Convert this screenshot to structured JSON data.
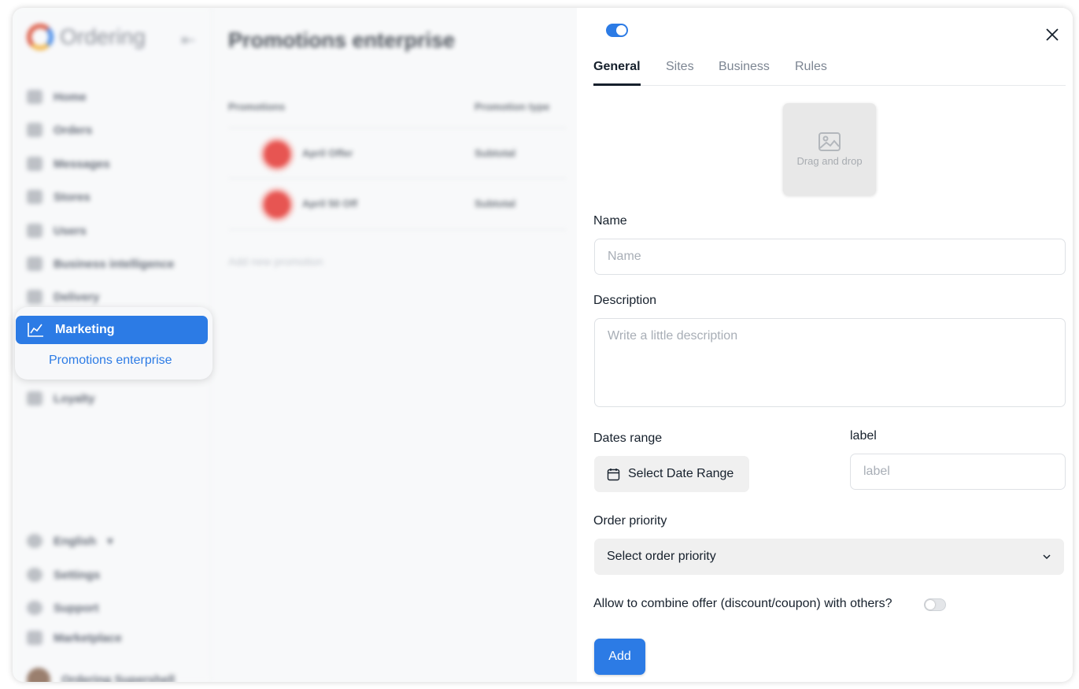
{
  "app": {
    "logo_text": "Ordering",
    "page_title": "Promotions enterprise"
  },
  "sidebar": {
    "items": [
      {
        "label": "Home"
      },
      {
        "label": "Orders"
      },
      {
        "label": "Messages"
      },
      {
        "label": "Stores"
      },
      {
        "label": "Users"
      },
      {
        "label": "Business intelligence"
      },
      {
        "label": "Delivery"
      },
      {
        "label": "Marketing",
        "active": true
      },
      {
        "label": "Loyalty"
      }
    ],
    "submenu": {
      "label": "Promotions enterprise"
    },
    "footer": [
      {
        "label": "English"
      },
      {
        "label": "Settings"
      },
      {
        "label": "Support"
      },
      {
        "label": "Marketplace"
      },
      {
        "label": "Ordering Supershell"
      }
    ]
  },
  "table": {
    "columns": [
      "Promotions",
      "Promotion type"
    ],
    "rows": [
      {
        "name": "April Offer",
        "type": "Subtotal"
      },
      {
        "name": "April 50 Off",
        "type": "Subtotal"
      }
    ],
    "add_link": "Add new promotion"
  },
  "panel": {
    "enabled": true,
    "tabs": [
      {
        "label": "General",
        "active": true
      },
      {
        "label": "Sites"
      },
      {
        "label": "Business"
      },
      {
        "label": "Rules"
      }
    ],
    "dropzone_text": "Drag and drop",
    "name": {
      "label": "Name",
      "placeholder": "Name",
      "value": ""
    },
    "description": {
      "label": "Description",
      "placeholder": "Write a little description",
      "value": ""
    },
    "dates": {
      "label": "Dates range",
      "button": "Select Date Range"
    },
    "tag": {
      "label": "label",
      "placeholder": "label",
      "value": ""
    },
    "order_priority": {
      "label": "Order priority",
      "value": "Select order priority"
    },
    "combine": {
      "label": "Allow to combine offer (discount/coupon) with others?",
      "enabled": false
    },
    "submit_label": "Add"
  },
  "colors": {
    "primary": "#2c7be5",
    "text": "#16202c",
    "muted": "#a8aeb6"
  }
}
